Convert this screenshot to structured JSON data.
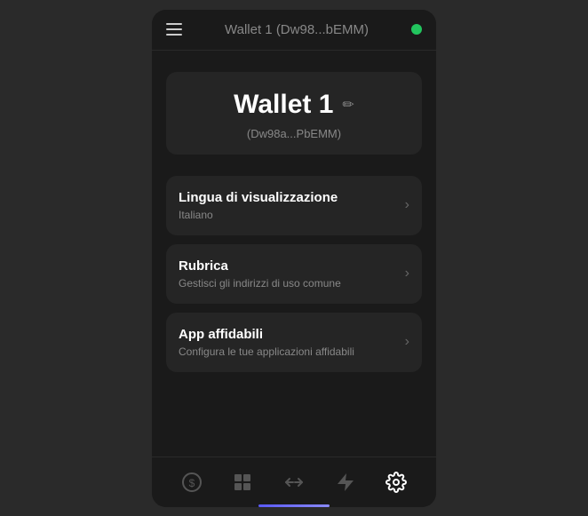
{
  "header": {
    "title": "Wallet 1",
    "address_short": "(Dw98...bEMM)",
    "status": "connected"
  },
  "wallet_card": {
    "name": "Wallet 1",
    "address": "(Dw98a...PbEMM)"
  },
  "menu_items": [
    {
      "title": "Lingua di visualizzazione",
      "subtitle": "Italiano"
    },
    {
      "title": "Rubrica",
      "subtitle": "Gestisci gli indirizzi di uso comune"
    },
    {
      "title": "App affidabili",
      "subtitle": "Configura le tue applicazioni affidabili"
    }
  ],
  "bottom_nav": [
    {
      "name": "wallet",
      "label": "wallet-icon",
      "active": false
    },
    {
      "name": "dashboard",
      "label": "dashboard-icon",
      "active": false
    },
    {
      "name": "transfer",
      "label": "transfer-icon",
      "active": false
    },
    {
      "name": "flash",
      "label": "flash-icon",
      "active": false
    },
    {
      "name": "settings",
      "label": "settings-icon",
      "active": true
    }
  ],
  "colors": {
    "accent": "#5a5aff",
    "status_green": "#22c55e",
    "background": "#1a1a1a",
    "card": "#252525"
  }
}
